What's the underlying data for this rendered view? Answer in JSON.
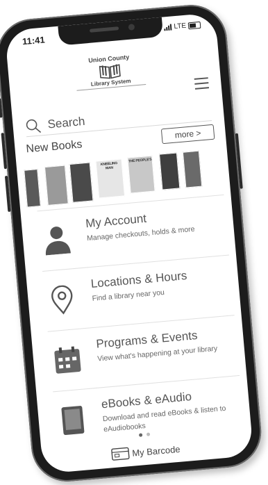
{
  "status_bar": {
    "time": "11:41",
    "network": "LTE"
  },
  "header": {
    "logo_line1": "Union County",
    "logo_line2": "Library System"
  },
  "search": {
    "placeholder": "Search"
  },
  "new_books": {
    "title": "New Books",
    "more_label": "more >",
    "covers": [
      {
        "label": "",
        "shade": "#5a5a5a"
      },
      {
        "label": "",
        "shade": "#9a9a9a"
      },
      {
        "label": "",
        "shade": "#4a4a4a"
      },
      {
        "label": "KNEELING MAN",
        "shade": "#e6e6e6"
      },
      {
        "label": "THE PEOPLE'S",
        "shade": "#c8c8c8"
      },
      {
        "label": "",
        "shade": "#3f3f3f"
      },
      {
        "label": "",
        "shade": "#6a6a6a"
      }
    ]
  },
  "menu_items": [
    {
      "title": "My Account",
      "subtitle": "Manage checkouts, holds & more",
      "icon": "person-icon"
    },
    {
      "title": "Locations & Hours",
      "subtitle": "Find a library near you",
      "icon": "location-pin-icon"
    },
    {
      "title": "Programs & Events",
      "subtitle": "View what's happening at your library",
      "icon": "calendar-icon"
    },
    {
      "title": "eBooks & eAudio",
      "subtitle": "Download and read eBooks & listen to eAudiobooks",
      "icon": "tablet-icon"
    }
  ],
  "pager": {
    "pages": 2,
    "active": 1
  },
  "footer": {
    "barcode_label": "My Barcode",
    "icon": "barcode-card-icon"
  }
}
